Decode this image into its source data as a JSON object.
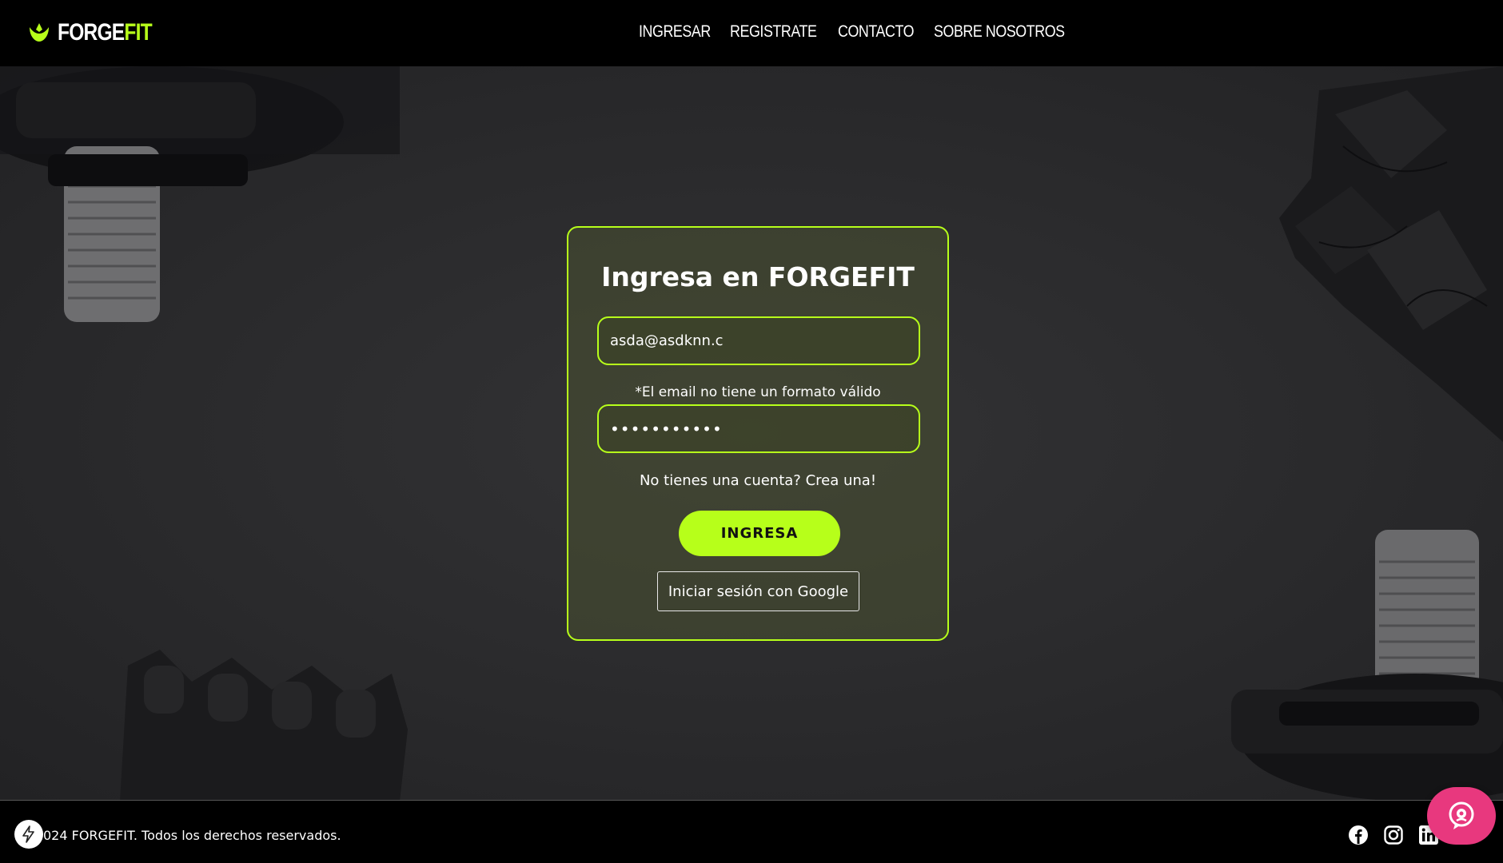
{
  "header": {
    "logo": {
      "part1": "FORGE",
      "part2": "FIT",
      "accent": "#b7ff1a"
    },
    "nav": [
      {
        "label": "INGRESAR"
      },
      {
        "label": "REGISTRATE"
      },
      {
        "label": "CONTACTO"
      },
      {
        "label": "SOBRE NOSOTROS"
      }
    ]
  },
  "login": {
    "title": "Ingresa en FORGEFIT",
    "email_value": "asda@asdknn.c",
    "email_error": "*El email no tiene un formato válido",
    "password_value": "•••••••••••",
    "signup_text": "No tienes una cuenta? Crea una!",
    "submit_label": "INGRESA",
    "google_label": "Iniciar sesión con Google"
  },
  "footer": {
    "copyright": "024 FORGEFIT. Todos los derechos reservados.",
    "socials": [
      "facebook-icon",
      "instagram-icon",
      "linkedin-icon"
    ]
  },
  "colors": {
    "accent": "#b7ff1a",
    "chat": "#e8387e"
  }
}
